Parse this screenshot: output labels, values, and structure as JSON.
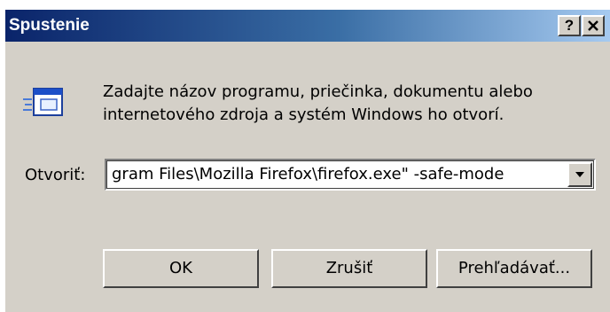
{
  "window": {
    "title": "Spustenie",
    "help_label": "?",
    "close_label": "x"
  },
  "description": {
    "line1": "Zadajte názov programu, priečinka, dokumentu alebo",
    "line2": "internetového zdroja a systém Windows ho otvorí."
  },
  "open_field": {
    "label": "Otvoriť:",
    "value": "gram Files\\Mozilla Firefox\\firefox.exe\" -safe-mode"
  },
  "buttons": {
    "ok": "OK",
    "cancel": "Zrušiť",
    "browse": "Prehľadávať..."
  },
  "icons": {
    "run": "run-program-icon",
    "dropdown": "dropdown-arrow-icon"
  },
  "colors": {
    "titlebar_start": "#0a246a",
    "titlebar_end": "#a6caf0",
    "dialog_face": "#d4d0c8"
  }
}
